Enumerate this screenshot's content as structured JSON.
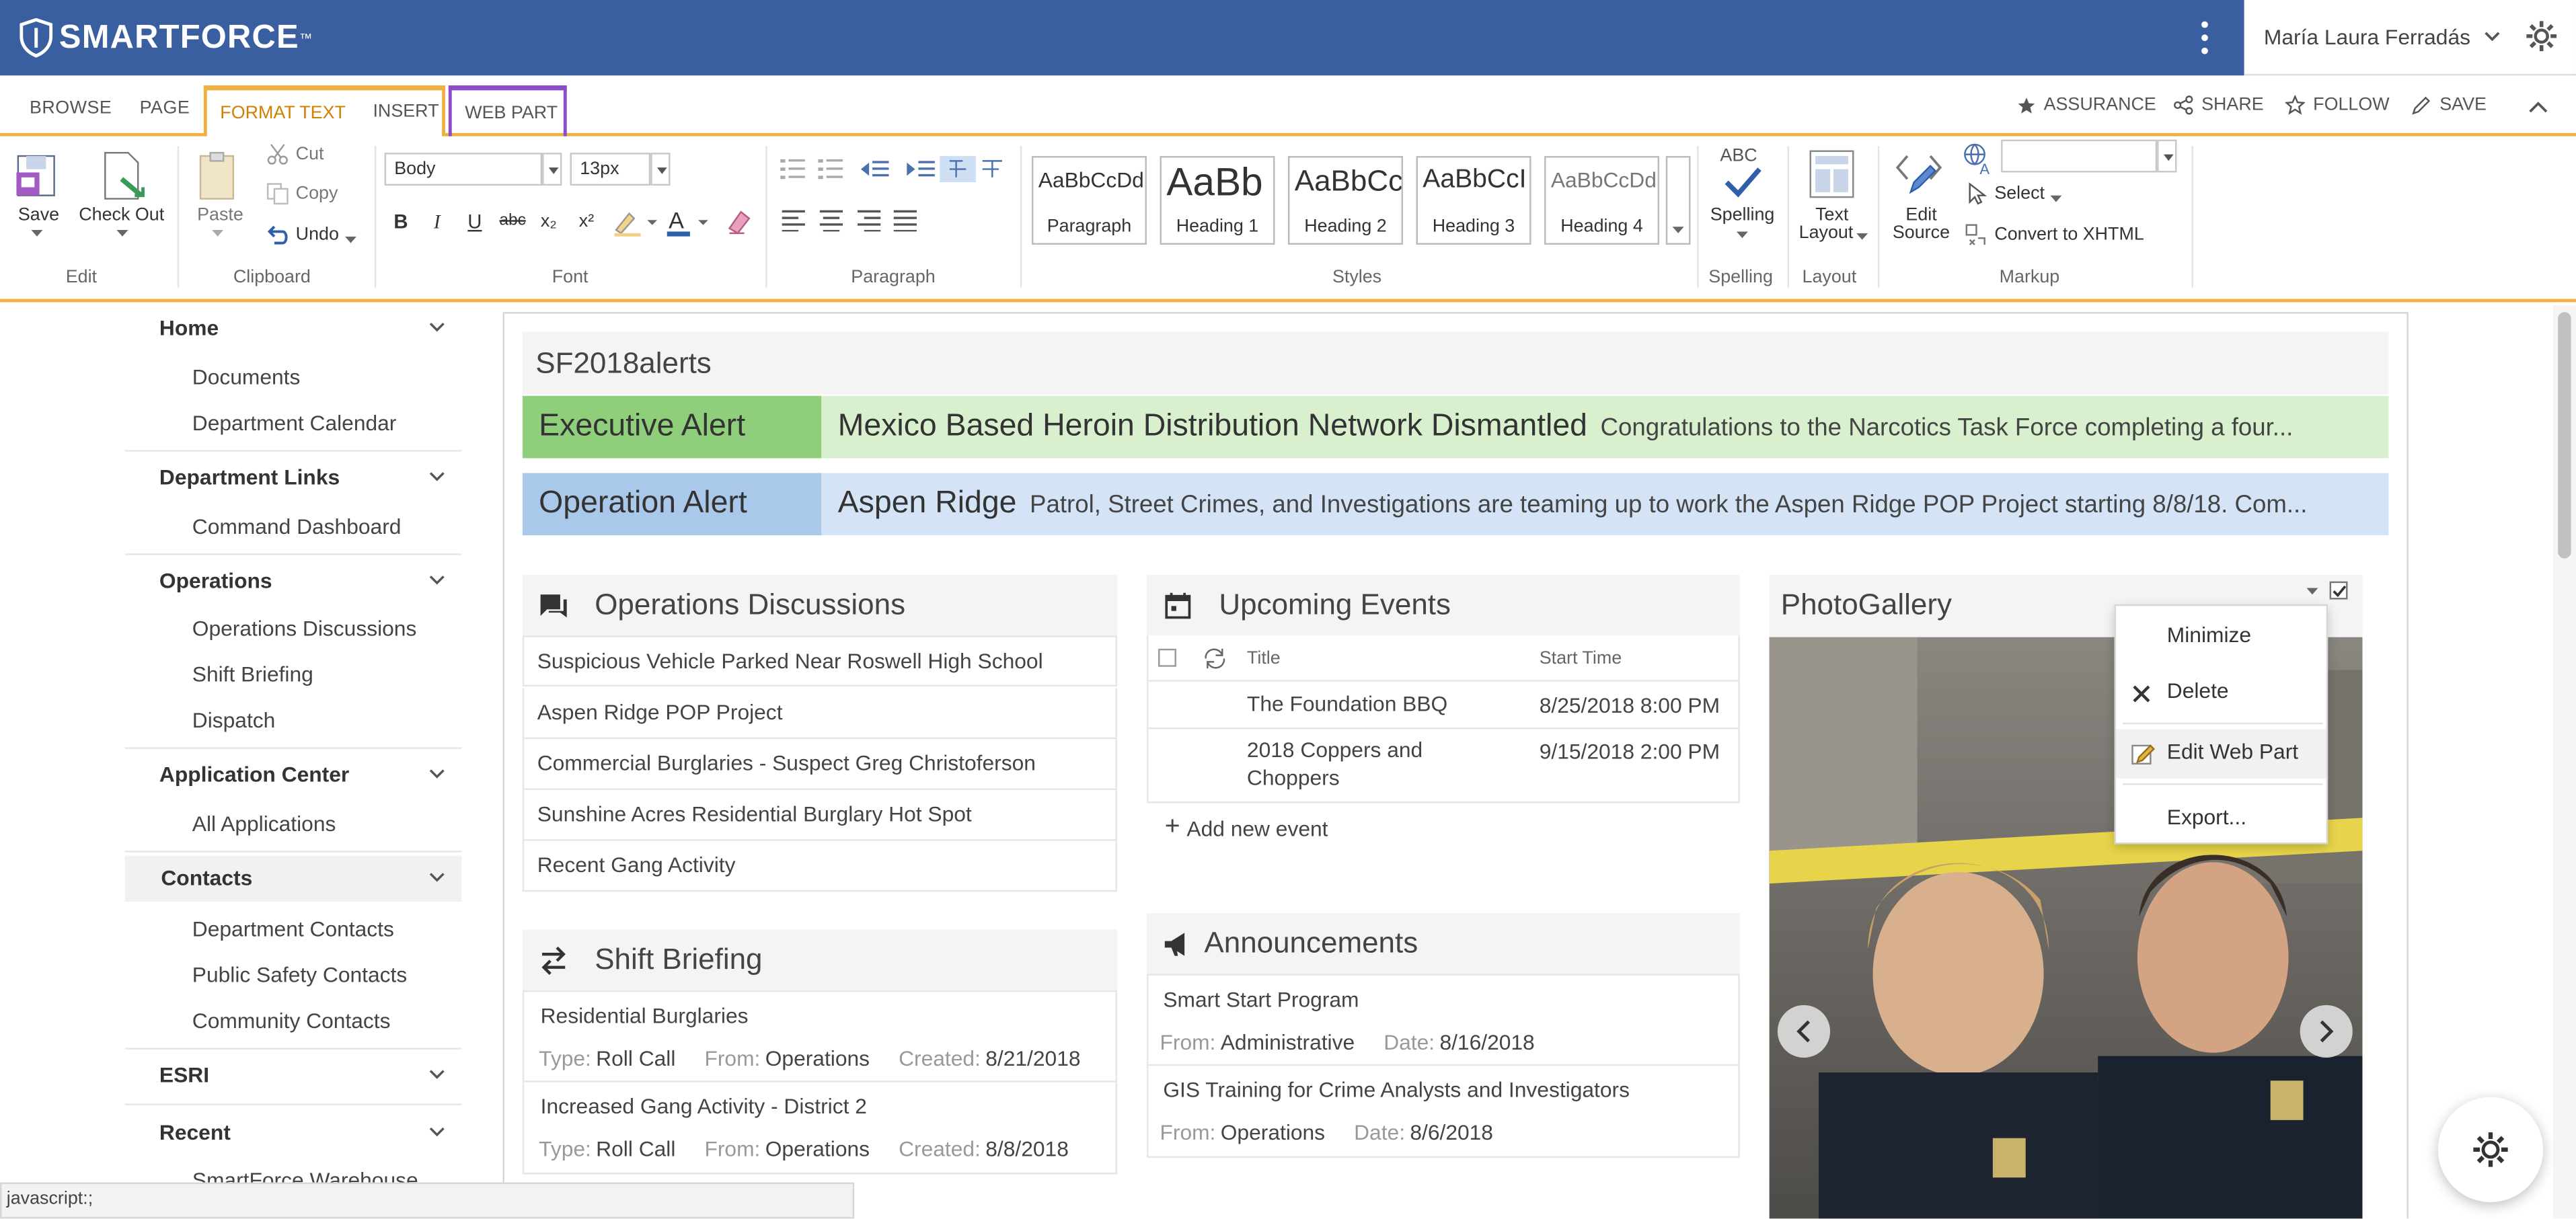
{
  "app": {
    "brand": "SMARTFORCE",
    "trademark": "™"
  },
  "user": {
    "name": "María Laura Ferradás"
  },
  "ribbon_tabs": [
    "BROWSE",
    "PAGE",
    "FORMAT TEXT",
    "INSERT",
    "WEB PART"
  ],
  "ribbon_actions": [
    "ASSURANCE",
    "SHARE",
    "FOLLOW",
    "SAVE"
  ],
  "ribbon": {
    "edit": {
      "save": "Save",
      "checkout": "Check Out",
      "group": "Edit"
    },
    "clipboard": {
      "paste": "Paste",
      "cut": "Cut",
      "copy": "Copy",
      "undo": "Undo",
      "group": "Clipboard"
    },
    "font": {
      "family": "Body",
      "size": "13px",
      "group": "Font"
    },
    "paragraph": {
      "group": "Paragraph"
    },
    "styles": {
      "group": "Styles",
      "tiles": [
        {
          "sample": "AaBbCcDdE",
          "name": "Paragraph"
        },
        {
          "sample": "AaBb",
          "name": "Heading 1"
        },
        {
          "sample": "AaBbCc",
          "name": "Heading 2"
        },
        {
          "sample": "AaBbCcI",
          "name": "Heading 3"
        },
        {
          "sample": "AaBbCcDdE",
          "name": "Heading 4"
        }
      ]
    },
    "spelling": {
      "label": "Spelling",
      "group": "Spelling",
      "abc": "ABC"
    },
    "layout": {
      "label": "Text Layout",
      "label1": "Text",
      "label2": "Layout",
      "group": "Layout"
    },
    "markup": {
      "edit_source1": "Edit",
      "edit_source2": "Source",
      "select": "Select",
      "convert": "Convert to XHTML",
      "group": "Markup"
    }
  },
  "nav": {
    "home": "Home",
    "documents": "Documents",
    "dept_calendar": "Department Calendar",
    "dept_links": "Department Links",
    "command_dashboard": "Command Dashboard",
    "operations": "Operations",
    "operations_discussions": "Operations Discussions",
    "shift_briefing": "Shift Briefing",
    "dispatch": "Dispatch",
    "app_center": "Application Center",
    "all_apps": "All Applications",
    "contacts": "Contacts",
    "dept_contacts": "Department Contacts",
    "public_safety_contacts": "Public Safety Contacts",
    "community_contacts": "Community Contacts",
    "esri": "ESRI",
    "recent": "Recent",
    "warehouse": "SmartForce Warehouse"
  },
  "zone": {
    "title": "SF2018alerts"
  },
  "alerts": [
    {
      "tag": "Executive Alert",
      "title": "Mexico Based Heroin Distribution Network Dismantled",
      "desc": "Congratulations to the Narcotics Task Force completing a four...",
      "tag_color": "#8fce7a",
      "body_color": "#d9f0cf"
    },
    {
      "tag": "Operation Alert",
      "title": "Aspen Ridge",
      "desc": "Patrol, Street Crimes, and Investigations are teaming up to work the Aspen Ridge POP Project starting 8/8/18. Com...",
      "tag_color": "#a9c8ea",
      "body_color": "#d4e4f6"
    }
  ],
  "discussions": {
    "title": "Operations Discussions",
    "items": [
      "Suspicious Vehicle Parked Near Roswell High School",
      "Aspen Ridge POP Project",
      "Commercial Burglaries - Suspect Greg Christoferson",
      "Sunshine Acres Residential Burglary Hot Spot",
      "Recent Gang Activity"
    ]
  },
  "events": {
    "title": "Upcoming Events",
    "col_title": "Title",
    "col_start": "Start Time",
    "rows": [
      {
        "title": "The Foundation BBQ",
        "start": "8/25/2018 8:00 PM"
      },
      {
        "title": "2018 Coppers and Choppers",
        "title1": "2018 Coppers and",
        "title2": "Choppers",
        "start": "9/15/2018 2:00 PM"
      }
    ],
    "add": "Add new event"
  },
  "briefing": {
    "title": "Shift Briefing",
    "items": [
      {
        "title": "Residential Burglaries",
        "type_k": "Type:",
        "type": "Roll Call",
        "from_k": "From:",
        "from": "Operations",
        "created_k": "Created:",
        "created": "8/21/2018"
      },
      {
        "title": "Increased Gang Activity - District 2",
        "type_k": "Type:",
        "type": "Roll Call",
        "from_k": "From:",
        "from": "Operations",
        "created_k": "Created:",
        "created": "8/8/2018"
      }
    ]
  },
  "announcements": {
    "title": "Announcements",
    "items": [
      {
        "title": "Smart Start Program",
        "from_k": "From:",
        "from": "Administrative",
        "date_k": "Date:",
        "date": "8/16/2018"
      },
      {
        "title": "GIS Training for Crime Analysts and Investigators",
        "from_k": "From:",
        "from": "Operations",
        "date_k": "Date:",
        "date": "8/6/2018"
      }
    ]
  },
  "gallery": {
    "title": "PhotoGallery"
  },
  "webpart_menu": [
    "Minimize",
    "Delete",
    "Edit Web Part",
    "Export..."
  ],
  "status": {
    "text": "javascript:;"
  },
  "colors": {
    "brand": "#3a5fa0",
    "ribbon_accent": "#f0b040",
    "webpart_tab": "#8a4cc8"
  }
}
